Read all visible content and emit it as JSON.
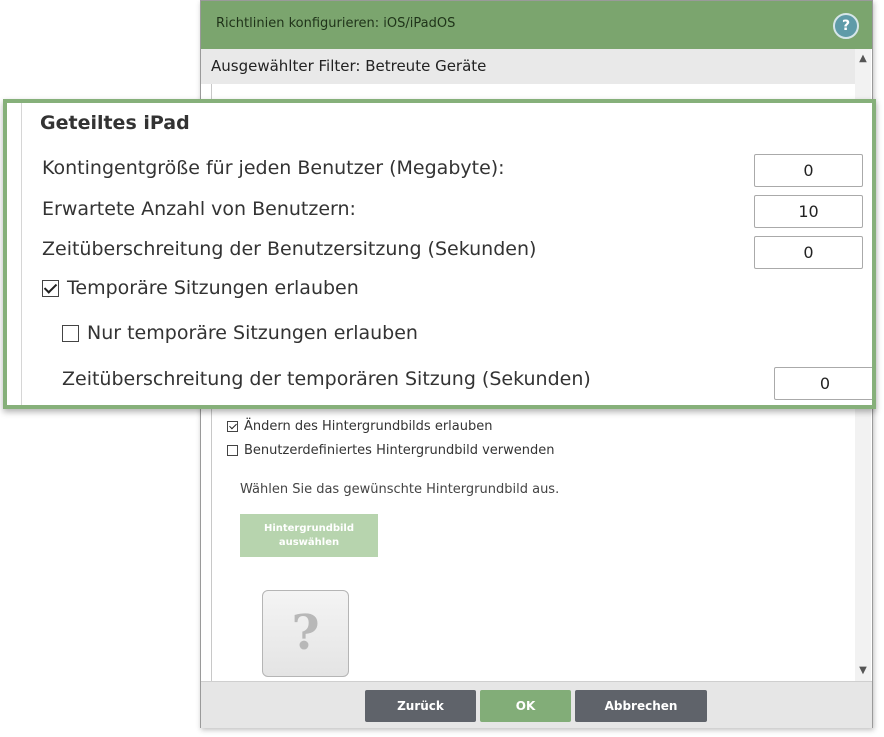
{
  "dialog": {
    "title": "Richtlinien konfigurieren: iOS/iPadOS",
    "help_glyph": "?",
    "filter_label": "Ausgewählter Filter: Betreute Geräte"
  },
  "settings": {
    "allow_wallpaper_change": {
      "label": "Ändern des Hintergrundbilds erlauben",
      "checked": true
    },
    "custom_wallpaper": {
      "label": "Benutzerdefiniertes Hintergrundbild verwenden",
      "checked": false
    },
    "wallpaper_hint": "Wählen Sie das gewünschte Hintergrundbild aus.",
    "wallpaper_button": "Hintergrundbild auswählen",
    "preview_glyph": "?"
  },
  "shared_ipad": {
    "heading": "Geteiltes iPad",
    "quota": {
      "label": "Kontingentgröße für jeden Benutzer (Megabyte):",
      "value": "0"
    },
    "expected_users": {
      "label": "Erwartete Anzahl von Benutzern:",
      "value": "10"
    },
    "session_timeout": {
      "label": "Zeitüberschreitung der Benutzersitzung (Sekunden)",
      "value": "0"
    },
    "allow_temp_sessions": {
      "label": "Temporäre Sitzungen erlauben",
      "checked": true
    },
    "only_temp_sessions": {
      "label": "Nur temporäre Sitzungen erlauben",
      "checked": false
    },
    "temp_session_timeout": {
      "label": "Zeitüberschreitung der temporären Sitzung (Sekunden)",
      "value": "0"
    }
  },
  "footer": {
    "back": "Zurück",
    "ok": "OK",
    "cancel": "Abbrechen"
  },
  "colors": {
    "titlebar": "#7ba56e",
    "callout_border": "#86b07a",
    "ok_button": "#82ad78",
    "dark_button": "#5f636a"
  },
  "icons": {
    "scroll_up": "▲",
    "scroll_down": "▼"
  }
}
